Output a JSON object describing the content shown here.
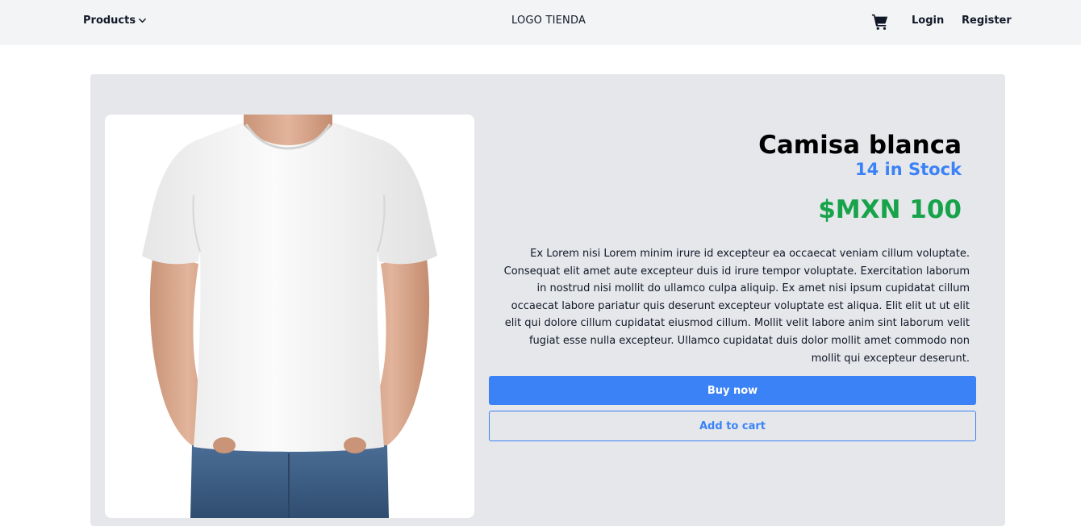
{
  "nav": {
    "products_label": "Products",
    "logo_text": "LOGO TIENDA",
    "login_label": "Login",
    "register_label": "Register",
    "icons": [
      "chevron-down-icon",
      "shopping-cart-icon"
    ]
  },
  "product": {
    "title": "Camisa blanca",
    "stock": "14 in Stock",
    "price": "$MXN 100",
    "description": "Ex Lorem nisi Lorem minim irure id excepteur ea occaecat veniam cillum voluptate. Consequat elit amet aute excepteur duis id irure tempor voluptate. Exercitation laborum in nostrud nisi mollit do ullamco culpa aliquip. Ex amet nisi ipsum cupidatat cillum occaecat labore pariatur quis deserunt excepteur voluptate est aliqua. Elit elit ut ut elit elit qui dolore cillum cupidatat eiusmod cillum. Mollit velit labore anim sint laborum velit fugiat esse nulla excepteur. Ullamco cupidatat duis dolor mollit amet commodo non mollit qui excepteur deserunt.",
    "buy_label": "Buy now",
    "add_to_cart_label": "Add to cart"
  },
  "colors": {
    "accent_blue": "#3b82f6",
    "price_green": "#16a34a",
    "card_bg": "#e5e7eb",
    "navbar_bg": "#f3f4f6"
  }
}
